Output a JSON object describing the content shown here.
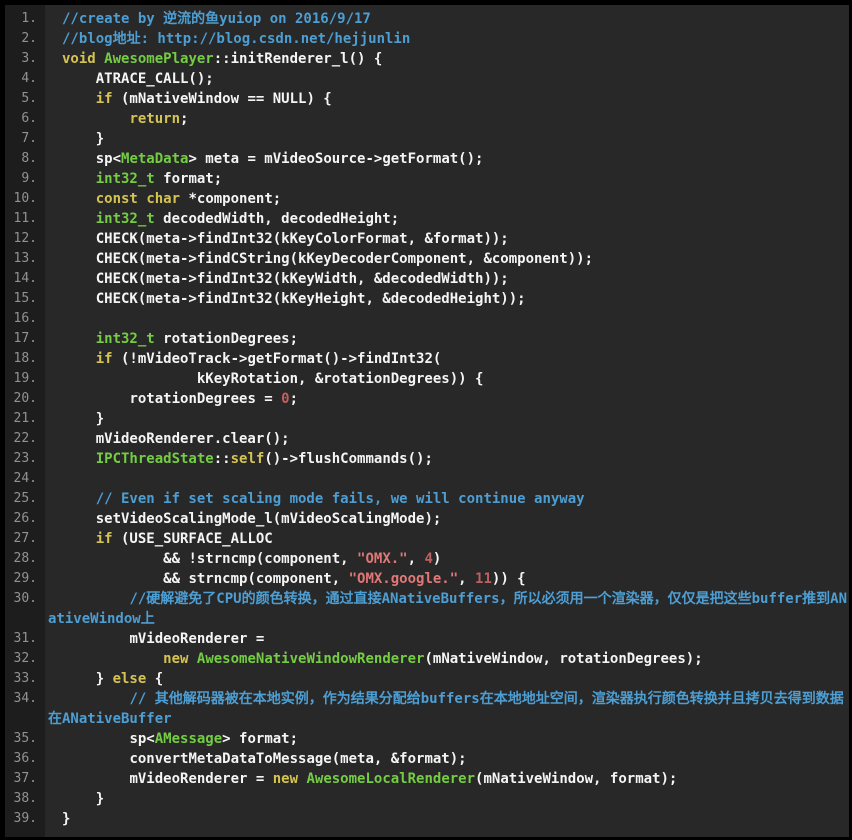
{
  "editor": {
    "description": "dark code editor view of C++ source AwesomePlayer::initRenderer_l",
    "colors": {
      "frame": "#000000",
      "background": "#282828",
      "gutter_bg": "#1d1d1d",
      "line_number": "#929292",
      "text": "#f5f5f5",
      "comment": "#4d9ed3",
      "keyword": "#d5c452",
      "type": "#74cd43",
      "string": "#e17878",
      "number": "#c05f5f"
    },
    "lines": [
      {
        "num": "1.",
        "seg": [
          [
            "c",
            "//create by 逆流的鱼yuiop on 2016/9/17"
          ]
        ]
      },
      {
        "num": "2.",
        "seg": [
          [
            "c",
            "//blog地址: http://blog.csdn.net/hejjunlin"
          ]
        ]
      },
      {
        "num": "3.",
        "seg": [
          [
            "k",
            "void"
          ],
          [
            "w",
            " "
          ],
          [
            "t",
            "AwesomePlayer"
          ],
          [
            "w",
            "::initRenderer_l() {"
          ]
        ]
      },
      {
        "num": "4.",
        "seg": [
          [
            "w",
            "    ATRACE_CALL();"
          ]
        ]
      },
      {
        "num": "5.",
        "seg": [
          [
            "w",
            "    "
          ],
          [
            "k",
            "if"
          ],
          [
            "w",
            " (mNativeWindow == NULL) {"
          ]
        ]
      },
      {
        "num": "6.",
        "seg": [
          [
            "w",
            "        "
          ],
          [
            "k",
            "return"
          ],
          [
            "w",
            ";"
          ]
        ]
      },
      {
        "num": "7.",
        "seg": [
          [
            "w",
            "    }"
          ]
        ]
      },
      {
        "num": "8.",
        "seg": [
          [
            "w",
            "    sp<"
          ],
          [
            "t",
            "MetaData"
          ],
          [
            "w",
            "> meta = mVideoSource->getFormat();"
          ]
        ]
      },
      {
        "num": "9.",
        "seg": [
          [
            "w",
            "    "
          ],
          [
            "t",
            "int32_t"
          ],
          [
            "w",
            " format;"
          ]
        ]
      },
      {
        "num": "10.",
        "seg": [
          [
            "w",
            "    "
          ],
          [
            "k",
            "const"
          ],
          [
            "w",
            " "
          ],
          [
            "k",
            "char"
          ],
          [
            "w",
            " *component;"
          ]
        ]
      },
      {
        "num": "11.",
        "seg": [
          [
            "w",
            "    "
          ],
          [
            "t",
            "int32_t"
          ],
          [
            "w",
            " decodedWidth, decodedHeight;"
          ]
        ]
      },
      {
        "num": "12.",
        "seg": [
          [
            "w",
            "    CHECK(meta->findInt32(kKeyColorFormat, &format));"
          ]
        ]
      },
      {
        "num": "13.",
        "seg": [
          [
            "w",
            "    CHECK(meta->findCString(kKeyDecoderComponent, &component));"
          ]
        ]
      },
      {
        "num": "14.",
        "seg": [
          [
            "w",
            "    CHECK(meta->findInt32(kKeyWidth, &decodedWidth));"
          ]
        ]
      },
      {
        "num": "15.",
        "seg": [
          [
            "w",
            "    CHECK(meta->findInt32(kKeyHeight, &decodedHeight));"
          ]
        ]
      },
      {
        "num": "16.",
        "seg": []
      },
      {
        "num": "17.",
        "seg": [
          [
            "w",
            "    "
          ],
          [
            "t",
            "int32_t"
          ],
          [
            "w",
            " rotationDegrees;"
          ]
        ]
      },
      {
        "num": "18.",
        "seg": [
          [
            "w",
            "    "
          ],
          [
            "k",
            "if"
          ],
          [
            "w",
            " (!mVideoTrack->getFormat()->findInt32("
          ]
        ]
      },
      {
        "num": "19.",
        "seg": [
          [
            "w",
            "                kKeyRotation, &rotationDegrees)) {"
          ]
        ]
      },
      {
        "num": "20.",
        "seg": [
          [
            "w",
            "        rotationDegrees = "
          ],
          [
            "n",
            "0"
          ],
          [
            "w",
            ";"
          ]
        ]
      },
      {
        "num": "21.",
        "seg": [
          [
            "w",
            "    }"
          ]
        ]
      },
      {
        "num": "22.",
        "seg": [
          [
            "w",
            "    mVideoRenderer.clear();"
          ]
        ]
      },
      {
        "num": "23.",
        "seg": [
          [
            "w",
            "    "
          ],
          [
            "t",
            "IPCThreadState"
          ],
          [
            "w",
            "::"
          ],
          [
            "k",
            "self"
          ],
          [
            "w",
            "()->flushCommands();"
          ]
        ]
      },
      {
        "num": "24.",
        "seg": []
      },
      {
        "num": "25.",
        "seg": [
          [
            "w",
            "    "
          ],
          [
            "c",
            "// Even if set scaling mode fails, we will continue anyway"
          ]
        ]
      },
      {
        "num": "26.",
        "seg": [
          [
            "w",
            "    setVideoScalingMode_l(mVideoScalingMode);"
          ]
        ]
      },
      {
        "num": "27.",
        "seg": [
          [
            "w",
            "    "
          ],
          [
            "k",
            "if"
          ],
          [
            "w",
            " (USE_SURFACE_ALLOC"
          ]
        ]
      },
      {
        "num": "28.",
        "seg": [
          [
            "w",
            "            && !strncmp(component, "
          ],
          [
            "s",
            "\"OMX.\""
          ],
          [
            "w",
            ", "
          ],
          [
            "n",
            "4"
          ],
          [
            "w",
            ")"
          ]
        ]
      },
      {
        "num": "29.",
        "seg": [
          [
            "w",
            "            && strncmp(component, "
          ],
          [
            "s",
            "\"OMX.google.\""
          ],
          [
            "w",
            ", "
          ],
          [
            "n",
            "11"
          ],
          [
            "w",
            ")) {"
          ]
        ]
      },
      {
        "num": "30.",
        "seg": [
          [
            "w",
            "        "
          ],
          [
            "c",
            "//硬解避免了CPU的颜色转换，通过直接ANativeBuffers，所以必须用一个渲染器，仅仅是把这些buffer推到ANativeWindow上"
          ]
        ]
      },
      {
        "num": "31.",
        "seg": [
          [
            "w",
            "        mVideoRenderer ="
          ]
        ]
      },
      {
        "num": "32.",
        "seg": [
          [
            "w",
            "            "
          ],
          [
            "k",
            "new"
          ],
          [
            "w",
            " "
          ],
          [
            "t",
            "AwesomeNativeWindowRenderer"
          ],
          [
            "w",
            "(mNativeWindow, rotationDegrees);"
          ]
        ]
      },
      {
        "num": "33.",
        "seg": [
          [
            "w",
            "    } "
          ],
          [
            "k",
            "else"
          ],
          [
            "w",
            " {"
          ]
        ]
      },
      {
        "num": "34.",
        "seg": [
          [
            "w",
            "        "
          ],
          [
            "c",
            "// 其他解码器被在本地实例，作为结果分配给buffers在本地地址空间，渲染器执行颜色转换并且拷贝去得到数据在ANativeBuffer"
          ]
        ]
      },
      {
        "num": "35.",
        "seg": [
          [
            "w",
            "        sp<"
          ],
          [
            "t",
            "AMessage"
          ],
          [
            "w",
            "> format;"
          ]
        ]
      },
      {
        "num": "36.",
        "seg": [
          [
            "w",
            "        convertMetaDataToMessage(meta, &format);"
          ]
        ]
      },
      {
        "num": "37.",
        "seg": [
          [
            "w",
            "        mVideoRenderer = "
          ],
          [
            "k",
            "new"
          ],
          [
            "w",
            " "
          ],
          [
            "t",
            "AwesomeLocalRenderer"
          ],
          [
            "w",
            "(mNativeWindow, format);"
          ]
        ]
      },
      {
        "num": "38.",
        "seg": [
          [
            "w",
            "    }"
          ]
        ]
      },
      {
        "num": "39.",
        "seg": [
          [
            "w",
            "}"
          ]
        ]
      }
    ]
  }
}
